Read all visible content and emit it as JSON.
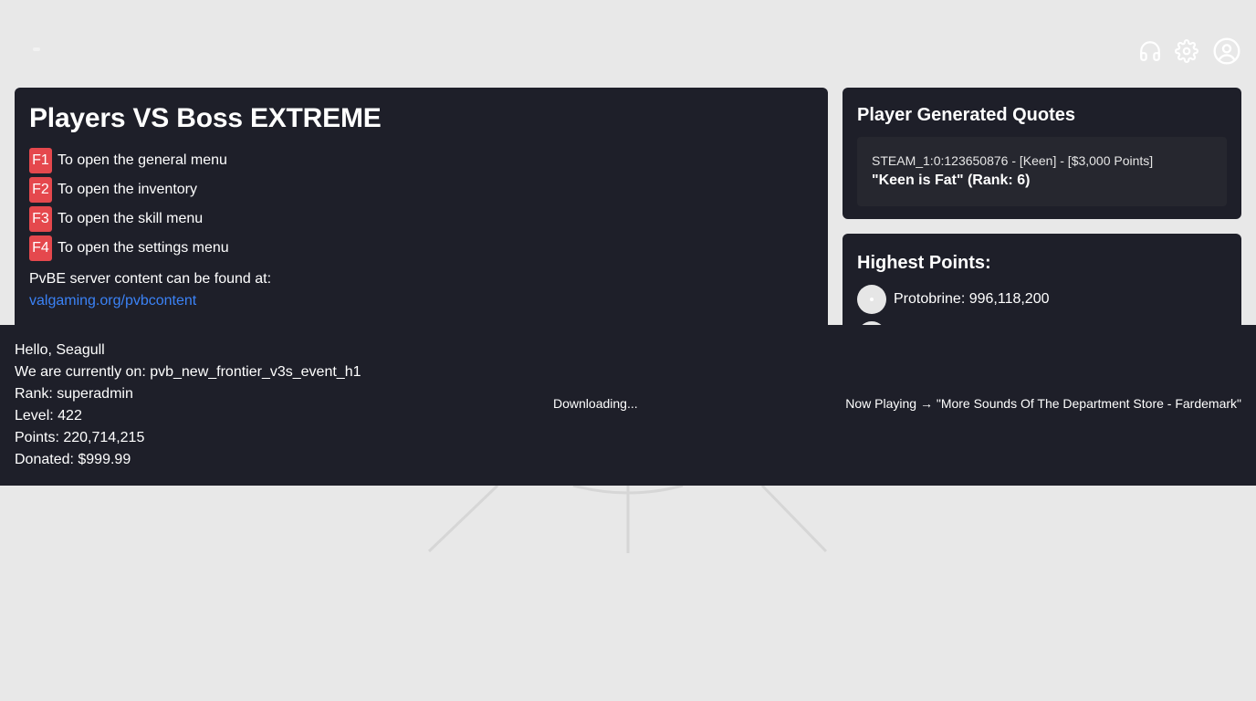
{
  "header": {
    "icons": [
      "headphones-icon",
      "gear-icon",
      "user-circle-icon"
    ]
  },
  "main": {
    "title": "Players VS Boss EXTREME",
    "keybinds": [
      {
        "key": "F1",
        "text": "To open the general menu"
      },
      {
        "key": "F2",
        "text": "To open the inventory"
      },
      {
        "key": "F3",
        "text": "To open the skill menu"
      },
      {
        "key": "F4",
        "text": "To open the settings menu"
      }
    ],
    "content_text": "PvBE server content can be found at:",
    "content_link": "valgaming.org/pvbcontent"
  },
  "quotes": {
    "title": "Player Generated Quotes",
    "meta": "STEAM_1:0:123650876 - [Keen] - [$3,000 Points]",
    "quote": "\"Keen is Fat\" (Rank: 6)"
  },
  "leaderboard": {
    "title": "Highest Points:",
    "entries": [
      {
        "text": "Protobrine: 996,118,200"
      },
      {
        "text": ""
      }
    ]
  },
  "footer": {
    "greeting": "Hello, Seagull",
    "map": "We are currently on: pvb_new_frontier_v3s_event_h1",
    "rank": "Rank: superadmin",
    "level": "Level: 422",
    "points": "Points: 220,714,215",
    "donated": "Donated: $999.99",
    "status": "Downloading...",
    "now_playing": "Now Playing → \"More Sounds Of The Department Store - Fardemark\""
  },
  "colors": {
    "background": "#e8e8e8",
    "panel": "#1e1f29",
    "key_badge": "#e5484d",
    "link": "#3b82f6"
  }
}
